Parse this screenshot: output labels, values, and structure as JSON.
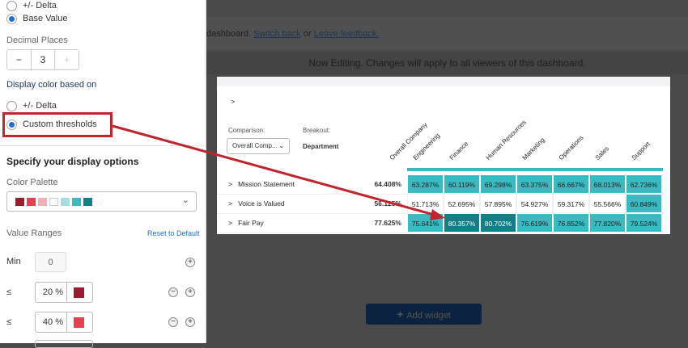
{
  "sidebar": {
    "prev_option": "+/- Delta",
    "base_value": "Base Value",
    "decimal_places_label": "Decimal Places",
    "decimal_value": "3",
    "minus": "−",
    "plus": "+",
    "display_color_label": "Display color based on",
    "option_delta": "+/- Delta",
    "option_custom": "Custom thresholds",
    "display_options_title": "Specify your display options",
    "color_palette_label": "Color Palette",
    "palette_colors": [
      "#9b1c2e",
      "#e5404f",
      "#f2afb5",
      "#ffffff",
      "#a4dce0",
      "#3bb8c0",
      "#127f84"
    ],
    "value_ranges_label": "Value Ranges",
    "reset_link": "Reset to Default",
    "min_label": "Min",
    "min_value": "0",
    "ranges": [
      {
        "op": "≤",
        "value": "20 %",
        "color": "#9b1c2e"
      },
      {
        "op": "≤",
        "value": "40 %",
        "color": "#e5404f"
      }
    ]
  },
  "background": {
    "banner_text": "dashboard.",
    "switch_back": "Switch back",
    "or": "or",
    "leave_feedback": "Leave feedback.",
    "editing_notice": "Now Editing. Changes will apply to all viewers of this dashboard.",
    "add_widget": "Add widget"
  },
  "widget": {
    "expand": ">",
    "comparison_label": "Comparison:",
    "comparison_value": "Overall Comp...",
    "breakout_label": "Breakout:",
    "breakout_value": "Department",
    "columns": [
      "Overall Company",
      "Engineering",
      "Finance",
      "Human Resources",
      "Marketing",
      "Operations",
      "Sales",
      "Support"
    ],
    "rows": [
      {
        "label": "Mission Statement",
        "overall": "64.408%",
        "values": [
          "63.287%",
          "60.119%",
          "69.298%",
          "63.375%",
          "66.667%",
          "68.013%",
          "62.736%"
        ],
        "levels": [
          "m",
          "m",
          "m",
          "m",
          "m",
          "m",
          "m"
        ]
      },
      {
        "label": "Voice is Valued",
        "overall": "56.125%",
        "values": [
          "51.713%",
          "52.695%",
          "57.895%",
          "54.927%",
          "59.317%",
          "55.566%",
          "60.849%"
        ],
        "levels": [
          "w",
          "w",
          "w",
          "w",
          "w",
          "w",
          "m"
        ]
      },
      {
        "label": "Fair Pay",
        "overall": "77.625%",
        "values": [
          "75.641%",
          "80.357%",
          "80.702%",
          "76.619%",
          "76.852%",
          "77.820%",
          "79.524%"
        ],
        "levels": [
          "m",
          "d",
          "d",
          "m",
          "m",
          "m",
          "m"
        ]
      }
    ]
  },
  "colors": {
    "accent": "#1a6fd8",
    "annotation": "#c0252e",
    "teal": "#3bb8c0",
    "dark_teal": "#127f84"
  }
}
